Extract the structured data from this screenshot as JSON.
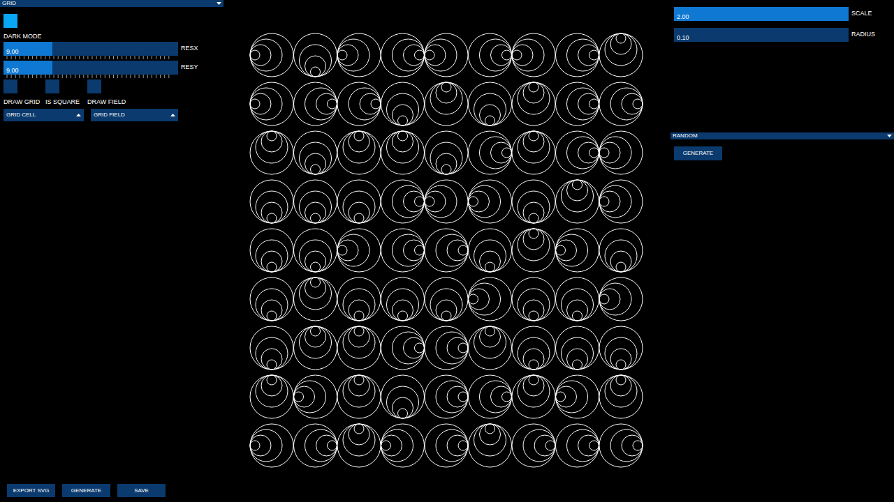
{
  "left_panel": {
    "title": "GRID",
    "dark_mode": {
      "label": "DARK MODE",
      "on": true
    },
    "sliders": [
      {
        "label": "RESX",
        "value": "9.00",
        "level": 0.28
      },
      {
        "label": "RESY",
        "value": "9.00",
        "level": 0.28
      }
    ],
    "toggles": [
      {
        "label": "DRAW GRID",
        "on": false
      },
      {
        "label": "IS SQUARE",
        "on": false
      },
      {
        "label": "DRAW FIELD",
        "on": false
      }
    ],
    "dropdowns": [
      {
        "label": "GRID CELL",
        "expanded": false
      },
      {
        "label": "GRID FIELD",
        "expanded": false
      }
    ],
    "buttons": [
      "EXPORT SVG",
      "GENERATE",
      "SAVE"
    ]
  },
  "right_panel": {
    "sliders": [
      {
        "label": "SCALE",
        "value": "2.00",
        "level": 1
      },
      {
        "label": "RADIUS",
        "value": "0.10",
        "level": 0
      }
    ],
    "section": {
      "title": "RANDOM",
      "button": "GENERATE"
    }
  },
  "canvas": {
    "cells": [
      [
        "left",
        "down",
        "left",
        "right",
        "left",
        "right",
        "left",
        "right",
        "up"
      ],
      [
        "left",
        "right",
        "right",
        "down",
        "up",
        "down",
        "up",
        "right",
        "right"
      ],
      [
        "up",
        "down",
        "up",
        "up",
        "down",
        "right",
        "up",
        "right",
        "left"
      ],
      [
        "down",
        "down",
        "down",
        "right",
        "left",
        "left",
        "down",
        "up",
        "left"
      ],
      [
        "down",
        "down",
        "left",
        "right",
        "right",
        "down",
        "up",
        "left",
        "down"
      ],
      [
        "down",
        "up",
        "down",
        "down",
        "down",
        "left",
        "down",
        "down",
        "left"
      ],
      [
        "down",
        "up",
        "up",
        "right",
        "right",
        "up",
        "down",
        "down",
        "down"
      ],
      [
        "up",
        "left",
        "up",
        "down",
        "right",
        "right",
        "up",
        "left",
        "up"
      ],
      [
        "left",
        "right",
        "up",
        "left",
        "right",
        "up",
        "right",
        "right",
        "right"
      ]
    ]
  }
}
